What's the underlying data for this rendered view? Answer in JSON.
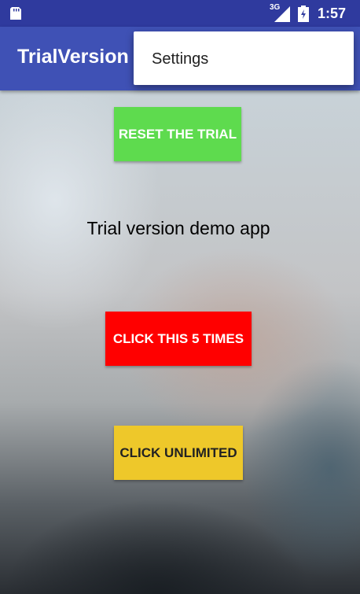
{
  "status_bar": {
    "network_type": "3G",
    "time": "1:57",
    "left_icon": "sd-card-icon",
    "signal_icon": "signal-icon",
    "battery_icon": "battery-charging-icon"
  },
  "app_bar": {
    "title": "TrialVersion"
  },
  "menu": {
    "items": [
      {
        "label": "Settings"
      }
    ]
  },
  "main": {
    "reset_button_label": "RESET THE TRIAL",
    "demo_text": "Trial version demo app",
    "click_five_label": "CLICK THIS 5 TIMES",
    "click_unlimited_label": "CLICK UNLIMITED"
  },
  "colors": {
    "status_bar": "#2f3a9e",
    "app_bar": "#3f51b5",
    "reset_button": "#5edb4e",
    "click_five_button": "#ff0000",
    "click_unlimited_button": "#eec82a"
  }
}
